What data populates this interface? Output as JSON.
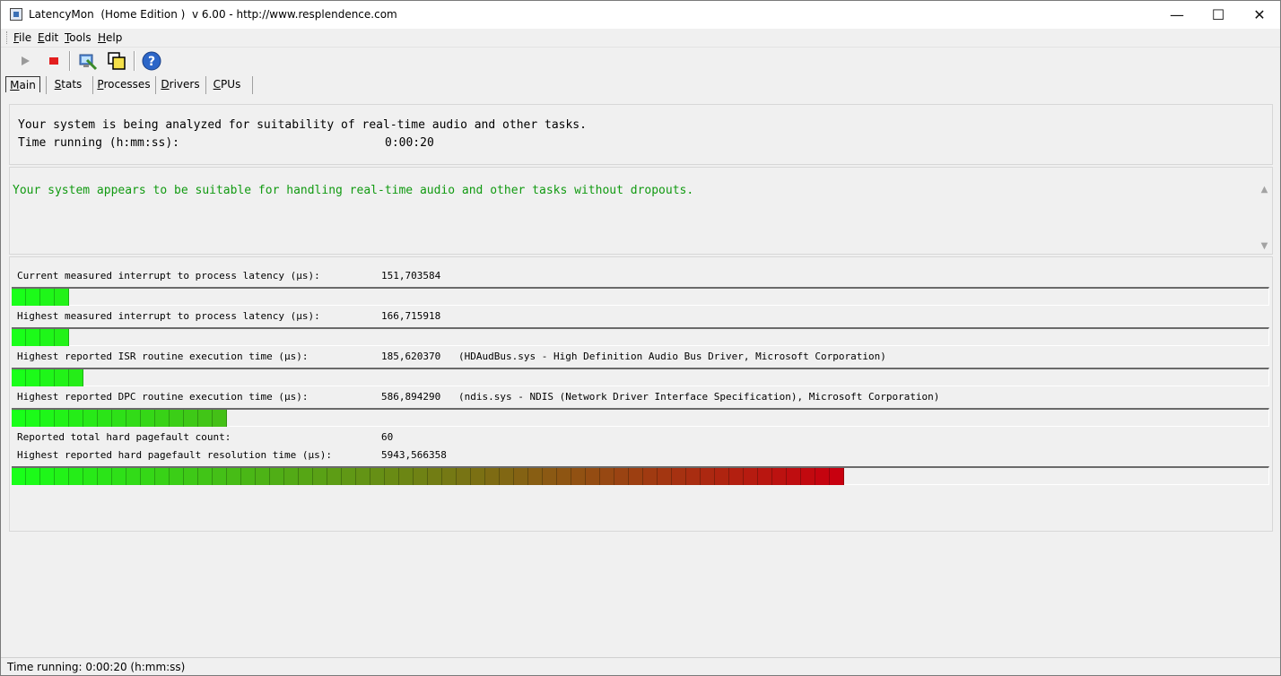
{
  "window": {
    "title": "LatencyMon  (Home Edition )  v 6.00 - http://www.resplendence.com",
    "minimize_glyph": "—",
    "maximize_glyph": "☐",
    "close_glyph": "✕"
  },
  "menu": [
    {
      "mnemonic": "F",
      "rest": "ile"
    },
    {
      "mnemonic": "E",
      "rest": "dit"
    },
    {
      "mnemonic": "T",
      "rest": "ools"
    },
    {
      "mnemonic": "H",
      "rest": "elp"
    }
  ],
  "toolbar": {
    "icons": [
      "play-icon",
      "stop-icon",
      "analyze-icon",
      "windows-icon",
      "help-icon"
    ],
    "colors": {
      "play": "#9a9a9a",
      "stop": "#e31e1e",
      "help": "#2c66c8"
    }
  },
  "tabs": [
    {
      "mnemonic": "M",
      "rest": "ain",
      "active": true
    },
    {
      "mnemonic": "S",
      "rest": "tats",
      "active": false
    },
    {
      "mnemonic": "P",
      "rest": "rocesses",
      "active": false
    },
    {
      "mnemonic": "D",
      "rest": "rivers",
      "active": false
    },
    {
      "mnemonic": "C",
      "rest": "PUs",
      "active": false
    }
  ],
  "status": {
    "line1": "Your system is being analyzed for suitability of real-time audio and other tasks.",
    "line2_label": "Time running (h:mm:ss):",
    "line2_value": "0:00:20"
  },
  "verdict": {
    "text": "Your system appears to be suitable for handling real-time audio and other tasks without dropouts.",
    "color": "#119a11"
  },
  "metrics": [
    {
      "label": "Current measured interrupt to process latency (µs):",
      "value": "151,703584",
      "extra": "",
      "segments": 4
    },
    {
      "label": "Highest measured interrupt to process latency (µs):",
      "value": "166,715918",
      "extra": "",
      "segments": 4
    },
    {
      "label": "Highest reported ISR routine execution time (µs):",
      "value": "185,620370",
      "extra": "(HDAudBus.sys - High Definition Audio Bus Driver, Microsoft Corporation)",
      "segments": 5
    },
    {
      "label": "Highest reported DPC routine execution time (µs):",
      "value": "586,894290",
      "extra": "(ndis.sys - NDIS (Network Driver Interface Specification), Microsoft Corporation)",
      "segments": 15
    },
    {
      "label": "Reported total hard pagefault count:",
      "value": "60",
      "extra": "",
      "segments": 0
    },
    {
      "label": "Highest reported hard pagefault resolution time (µs):",
      "value": "5943,566358",
      "extra": "",
      "segments": 58
    }
  ],
  "bar_colors": {
    "start": "#19ff19",
    "end": "#c8000f"
  },
  "statusbar": {
    "text": "Time running: 0:00:20  (h:mm:ss)"
  }
}
